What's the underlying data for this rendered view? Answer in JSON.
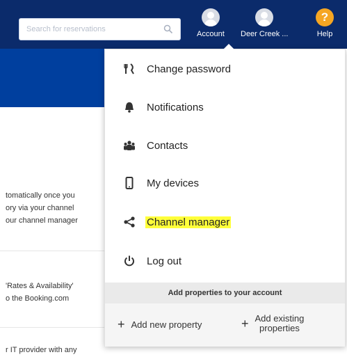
{
  "topbar": {
    "search": {
      "placeholder": "Search for reservations"
    },
    "account_label": "Account",
    "property_label": "Deer Creek ...",
    "help_label": "Help",
    "help_symbol": "?"
  },
  "background_text": {
    "line1": "tomatically once you",
    "line2": "ory via your channel",
    "line3": "our channel manager",
    "line4": "'Rates & Availability'",
    "line5": "o the Booking.com",
    "line6": "r IT provider with any"
  },
  "dropdown": {
    "items": [
      {
        "label": "Change password",
        "icon": "utensils-icon"
      },
      {
        "label": "Notifications",
        "icon": "bell-icon"
      },
      {
        "label": "Contacts",
        "icon": "users-icon"
      },
      {
        "label": "My devices",
        "icon": "mobile-icon"
      },
      {
        "label": "Channel manager",
        "icon": "share-icon",
        "highlighted": true
      },
      {
        "label": "Log out",
        "icon": "power-icon"
      }
    ],
    "add_header": "Add properties to your account",
    "add_new": "Add new property",
    "add_existing_line1": "Add existing",
    "add_existing_line2": "properties",
    "plus_symbol": "+"
  },
  "colors": {
    "topbar": "#0b2b6b",
    "banner": "#003f9e",
    "highlight": "#ffff3a",
    "help": "#f5a623"
  }
}
